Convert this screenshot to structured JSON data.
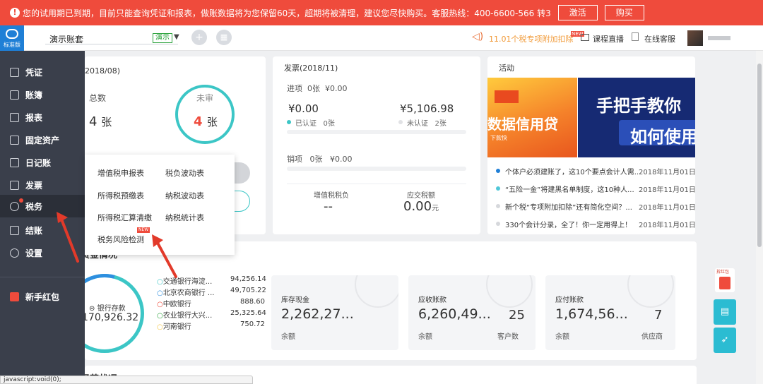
{
  "banner": {
    "message": "您的试用期已到期，目前只能查询凭证和报表，做账数据将为您保留60天，超期将被清理，建议您尽快购买。客服热线：400-6600-566 转3",
    "activate_label": "激活",
    "buy_label": "购买",
    "color": "#ef4b3c"
  },
  "header": {
    "logo_label": "标准版",
    "account_name": "演示账套",
    "demo_badge": "演示",
    "ticker": "11.01个税专项附加扣除",
    "new_tag": "NEW",
    "course_label": "课程直播",
    "service_label": "在线客服"
  },
  "sidebar": {
    "items": [
      {
        "label": "凭证",
        "icon": "voucher-icon"
      },
      {
        "label": "账簿",
        "icon": "ledger-icon"
      },
      {
        "label": "报表",
        "icon": "report-icon"
      },
      {
        "label": "固定资产",
        "icon": "asset-icon"
      },
      {
        "label": "日记账",
        "icon": "journal-icon"
      },
      {
        "label": "发票",
        "icon": "invoice-icon"
      },
      {
        "label": "税务",
        "icon": "tax-icon"
      },
      {
        "label": "结账",
        "icon": "close-books-icon"
      },
      {
        "label": "设置",
        "icon": "gear-icon"
      }
    ],
    "red_packet_label": "新手红包"
  },
  "voucher_card": {
    "title": "2018/08)",
    "total_label": "总数",
    "total_value": "4",
    "total_unit": "张",
    "unreviewed_label": "未审",
    "unreviewed_value": "4",
    "unreviewed_unit": "张"
  },
  "invoice_card": {
    "title": "发票(2018/11)",
    "input_label": "进项",
    "input_count": "0张",
    "input_amount": "¥0.00",
    "certified_amount": "¥0.00",
    "certified_label": "已认证",
    "certified_count": "0张",
    "uncertified_amount": "¥5,106.98",
    "uncertified_label": "未认证",
    "uncertified_count": "2张",
    "output_label": "销项",
    "output_count": "0张",
    "output_amount": "¥0.00",
    "vat_burden_label": "增值税税负",
    "vat_burden_value": "--",
    "tax_payable_label": "应交税额",
    "tax_payable_value": "0.00",
    "tax_payable_unit": "元"
  },
  "activity_card": {
    "title": "活动",
    "banner_left_text": "数据信用贷",
    "banner_left_sub": "下款快",
    "banner_right_line1": "手把手教你",
    "banner_right_line2": "如何使用",
    "news": [
      {
        "title": "个体户必须建账了，这10个要点会计人需...",
        "date": "2018年11月01日",
        "dot_color": "#1f7fd6"
      },
      {
        "title": "“五险一金”将建黑名单制度，这10种人...",
        "date": "2018年11月01日",
        "dot_color": "#4fc7d8"
      },
      {
        "title": "新个税“专项附加扣除”还有简化空间？...",
        "date": "2018年11月01日",
        "dot_color": "#d6d8dc"
      },
      {
        "title": "330个会计分录，全了！你一定用得上！",
        "date": "2018年11月01日",
        "dot_color": "#d6d8dc"
      }
    ]
  },
  "funds": {
    "section_title": "资金情况",
    "bank_label": "银行存款",
    "bank_total": "170,926.32",
    "banks": [
      {
        "name": "交通银行海淀...",
        "amount": "94,256.14"
      },
      {
        "name": "北京农商银行 ...",
        "amount": "49,705.22"
      },
      {
        "name": "中欧银行",
        "amount": "888.60"
      },
      {
        "name": "农业银行大兴...",
        "amount": "25,325.64"
      },
      {
        "name": "河南银行",
        "amount": "750.72"
      }
    ],
    "cash_label": "库存现金",
    "cash_value": "2,262,27...",
    "cash_sub": "余额",
    "receivable_label": "应收账款",
    "receivable_value": "6,260,49...",
    "receivable_sub": "余额",
    "receivable_count": "25",
    "receivable_count_label": "客户数",
    "payable_label": "应付账款",
    "payable_value": "1,674,56...",
    "payable_sub": "余额",
    "payable_count": "7",
    "payable_count_label": "供应商"
  },
  "bottom_title": "经营状况",
  "tax_popup": {
    "items": [
      "增值税申报表",
      "税负波动表",
      "所得税预缴表",
      "纳税波动表",
      "所得税汇算清缴",
      "纳税统计表",
      "税务风险检测"
    ],
    "new_badge": "NEW"
  },
  "right_float": {
    "red_packet": "拆红包"
  },
  "status_bar": "javascript:void(0);"
}
